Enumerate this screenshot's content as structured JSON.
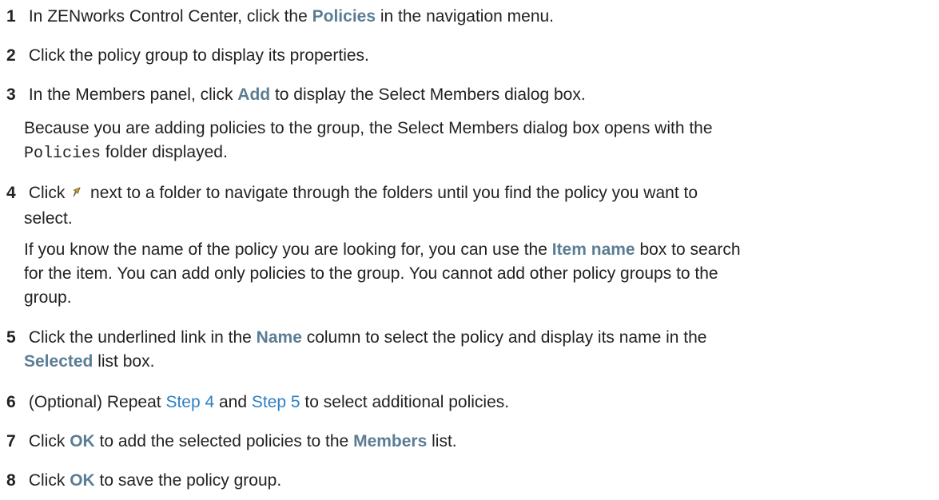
{
  "steps": [
    {
      "number": "1",
      "t1": "In ZENworks Control Center, click the ",
      "ui1": "Policies",
      "t2": " in the navigation menu."
    },
    {
      "number": "2",
      "text": "Click the policy group to display its properties."
    },
    {
      "number": "3",
      "t1": "In the Members panel, click ",
      "ui1": "Add",
      "t2": " to display the Select Members dialog box.",
      "note_l1": "Because you are adding policies to the group, the Select Members dialog box opens with the",
      "note_code": "Policies",
      "note_l2": " folder displayed."
    },
    {
      "number": "4",
      "t1": "Click ",
      "icon": "navigate-arrow-icon",
      "t2": " next to a folder to navigate through the folders until you find the policy you want to",
      "t3": "select.",
      "note_l1a": "If you know the name of the policy you are looking for, you can use the ",
      "note_ui": "Item name",
      "note_l1b": " box to search",
      "note_l2": "for the item. You can add only policies to the group. You cannot add other policy groups to the",
      "note_l3": "group."
    },
    {
      "number": "5",
      "t1": "Click the underlined link in the ",
      "ui1": "Name",
      "t2": " column to select the policy and display its name in the",
      "ui2": "Selected",
      "t3": " list box."
    },
    {
      "number": "6",
      "t1": "(Optional) Repeat ",
      "link1": "Step 4",
      "t2": " and ",
      "link2": "Step 5",
      "t3": " to select additional policies."
    },
    {
      "number": "7",
      "t1": "Click ",
      "ui1": "OK",
      "t2": " to add the selected policies to the ",
      "ui2": "Members",
      "t3": " list."
    },
    {
      "number": "8",
      "t1": "Click ",
      "ui1": "OK",
      "t2": " to save the policy group."
    }
  ],
  "colors": {
    "text": "#222222",
    "ui_term": "#5b7d94",
    "link": "#2e7fc2",
    "icon": "#c8a02a"
  }
}
